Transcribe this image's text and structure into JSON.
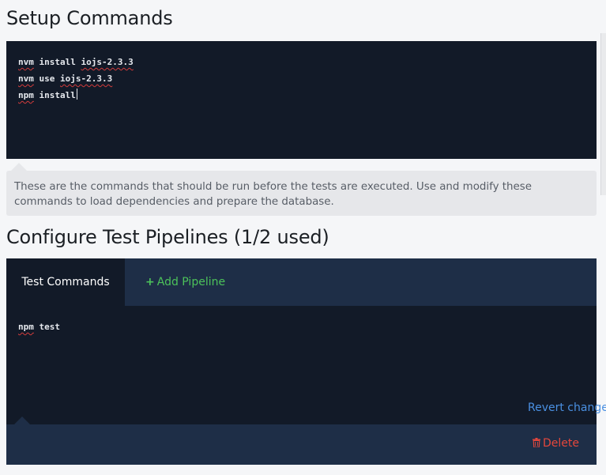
{
  "setup": {
    "title": "Setup Commands",
    "commands": [
      {
        "cmd": "nvm",
        "rest": " install ",
        "arg": "iojs-2.3.3"
      },
      {
        "cmd": "nvm",
        "rest": " use ",
        "arg": "iojs-2.3.3"
      },
      {
        "cmd": "npm",
        "rest": " install",
        "arg": ""
      }
    ],
    "hint": "These are the commands that should be run before the tests are executed. Use and modify these commands to load dependencies and prepare the database."
  },
  "pipelines": {
    "title": "Configure Test Pipelines (1/2 used)",
    "tabs": {
      "active_label": "Test Commands",
      "add_label": "Add Pipeline"
    },
    "test_commands": [
      {
        "cmd": "npm",
        "rest": " test"
      }
    ],
    "revert_label": "Revert changes",
    "delete_label": "Delete"
  },
  "colors": {
    "editor_bg": "#121a28",
    "header_bg": "#1e2e47",
    "add_green": "#4cc25a",
    "link_blue": "#4a90e2",
    "delete_red": "#e5473c"
  },
  "icons": {
    "add": "plus-icon",
    "delete": "trash-icon"
  }
}
